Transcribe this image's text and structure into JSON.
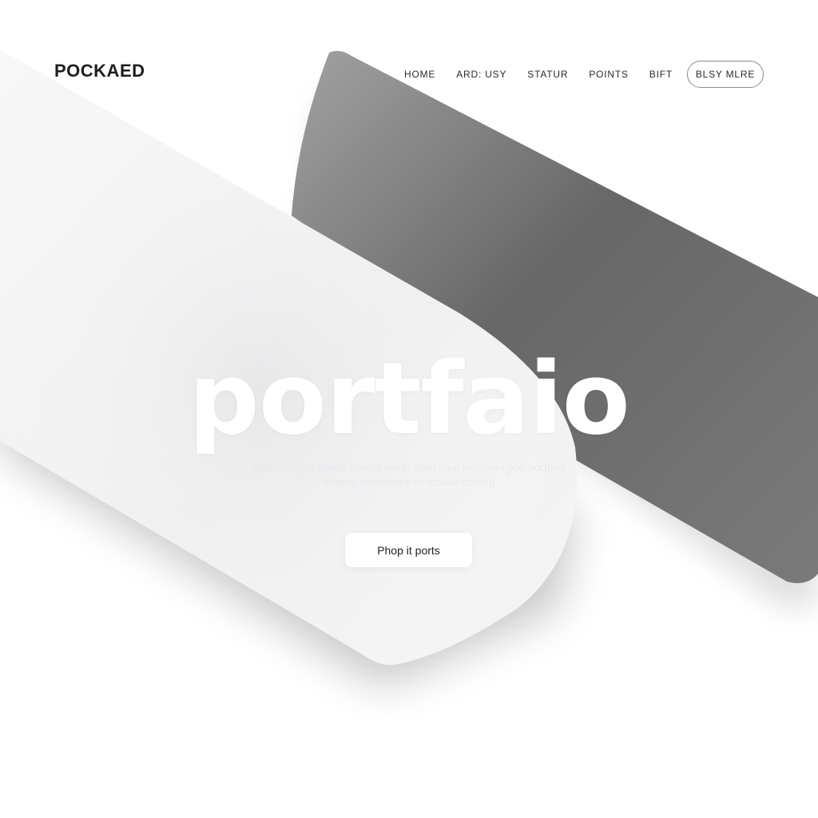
{
  "brand": {
    "logo_text": "POCKAED"
  },
  "nav": {
    "items": [
      {
        "label": "HOME"
      },
      {
        "label": "ARD: USY"
      },
      {
        "label": "STATUR"
      },
      {
        "label": "POINTS"
      },
      {
        "label": "BIFT"
      }
    ],
    "cta_label": "BLSY MLRE"
  },
  "hero": {
    "title": "portfaio",
    "subtitle_line1": "Etre Losign Lopren lrervet esign afen youl pecthologice portfres",
    "subtitle_line2": "entess to meance in diciate cening",
    "button_label": "Phop it ports"
  },
  "colors": {
    "background": "#ffffff",
    "dark_band": "#6e6e6e",
    "light_band": "#f3f3f3",
    "text_dark": "#1e1e1e"
  }
}
